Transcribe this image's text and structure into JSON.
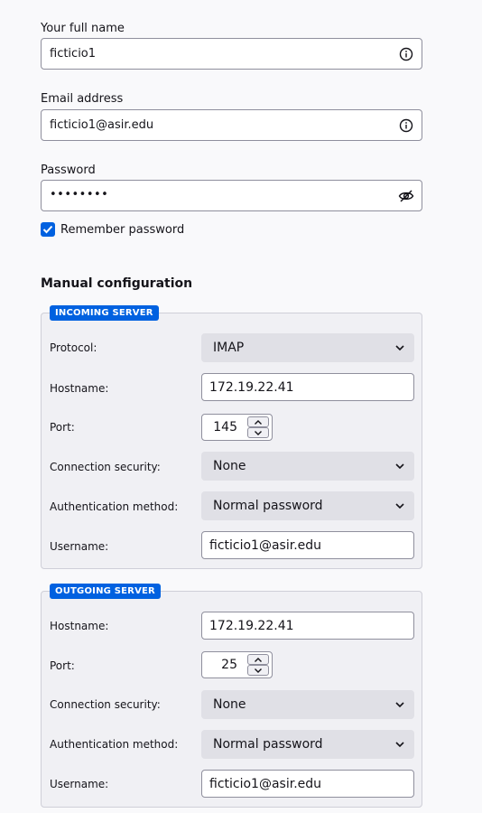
{
  "account": {
    "name_label": "Your full name",
    "name_value": "ficticio1",
    "email_label": "Email address",
    "email_value": "ficticio1@asir.edu",
    "password_label": "Password",
    "password_mask": "••••••••",
    "remember_label": "Remember password",
    "remember_checked": true
  },
  "manual": {
    "heading": "Manual configuration",
    "incoming": {
      "tag": "INCOMING SERVER",
      "protocol_label": "Protocol:",
      "protocol_value": "IMAP",
      "hostname_label": "Hostname:",
      "hostname_value": "172.19.22.41",
      "port_label": "Port:",
      "port_value": "145",
      "security_label": "Connection security:",
      "security_value": "None",
      "auth_label": "Authentication method:",
      "auth_value": "Normal password",
      "username_label": "Username:",
      "username_value": "ficticio1@asir.edu"
    },
    "outgoing": {
      "tag": "OUTGOING SERVER",
      "hostname_label": "Hostname:",
      "hostname_value": "172.19.22.41",
      "port_label": "Port:",
      "port_value": "25",
      "security_label": "Connection security:",
      "security_value": "None",
      "auth_label": "Authentication method:",
      "auth_value": "Normal password",
      "username_label": "Username:",
      "username_value": "ficticio1@asir.edu"
    }
  },
  "colors": {
    "accent": "#0061e0",
    "page_bg": "#f9f9fb",
    "box_bg": "#f0f0f4",
    "select_bg": "#e0e0e6"
  }
}
